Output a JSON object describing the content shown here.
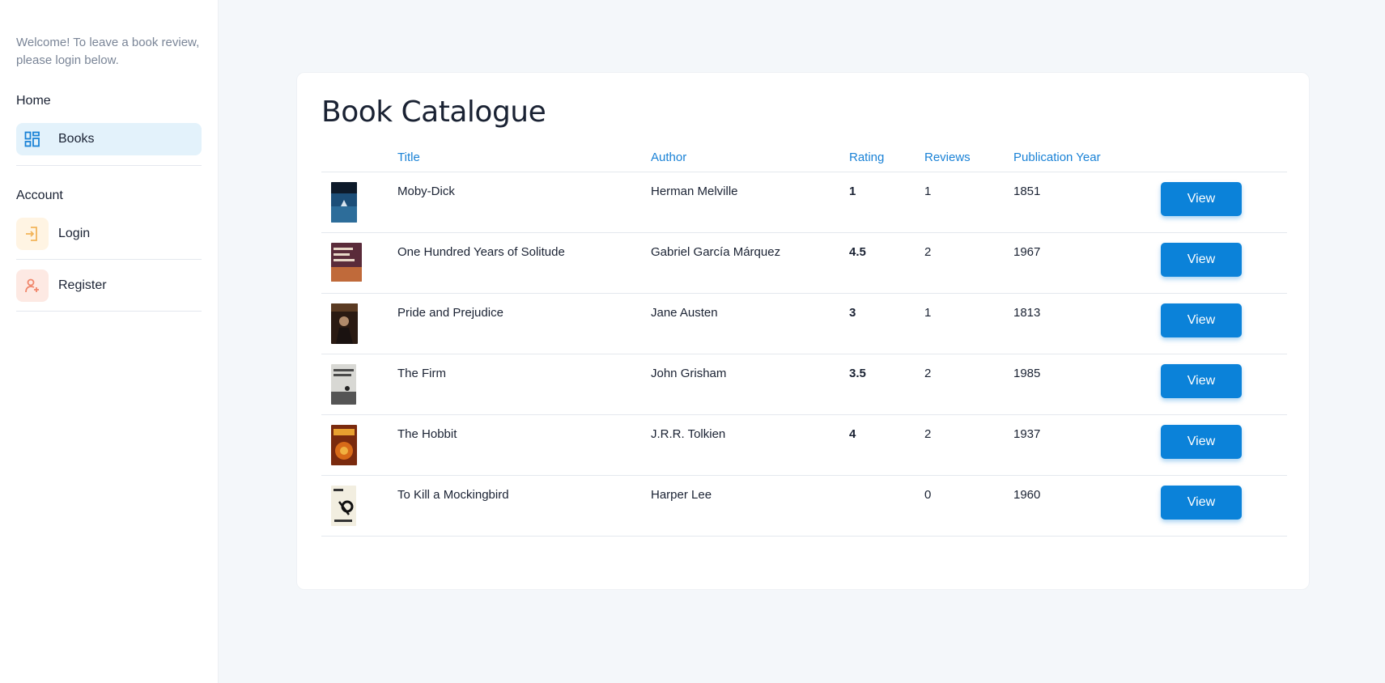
{
  "sidebar": {
    "welcome": "Welcome! To leave a book review, please login below.",
    "home_heading": "Home",
    "books_label": "Books",
    "account_heading": "Account",
    "login_label": "Login",
    "register_label": "Register"
  },
  "catalogue": {
    "title": "Book Catalogue",
    "headers": {
      "title": "Title",
      "author": "Author",
      "rating": "Rating",
      "reviews": "Reviews",
      "year": "Publication Year"
    },
    "view_label": "View",
    "rows": [
      {
        "title": "Moby-Dick",
        "author": "Herman Melville",
        "rating": "1",
        "reviews": "1",
        "year": "1851"
      },
      {
        "title": "One Hundred Years of Solitude",
        "author": "Gabriel García Márquez",
        "rating": "4.5",
        "reviews": "2",
        "year": "1967"
      },
      {
        "title": "Pride and Prejudice",
        "author": "Jane Austen",
        "rating": "3",
        "reviews": "1",
        "year": "1813"
      },
      {
        "title": "The Firm",
        "author": "John Grisham",
        "rating": "3.5",
        "reviews": "2",
        "year": "1985"
      },
      {
        "title": "The Hobbit",
        "author": "J.R.R. Tolkien",
        "rating": "4",
        "reviews": "2",
        "year": "1937"
      },
      {
        "title": "To Kill a Mockingbird",
        "author": "Harper Lee",
        "rating": "",
        "reviews": "0",
        "year": "1960"
      }
    ]
  },
  "colors": {
    "accent": "#0b82d9",
    "header_text": "#1a82d6",
    "active_nav_bg": "#e3f2fb"
  }
}
